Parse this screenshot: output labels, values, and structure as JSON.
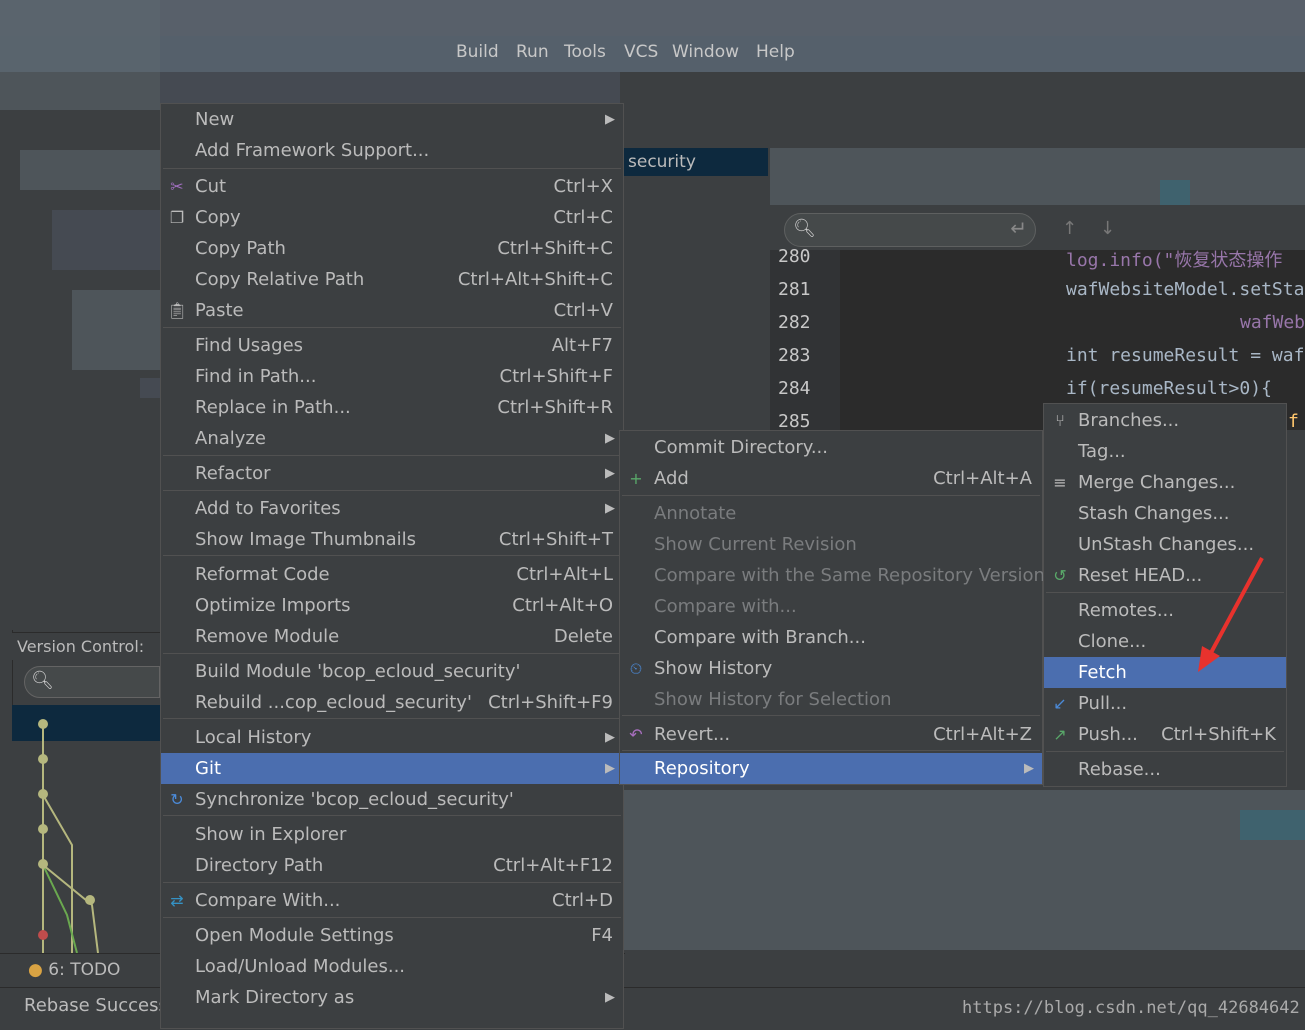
{
  "menubar": {
    "items": [
      "Build",
      "Run",
      "Tools",
      "VCS",
      "Window",
      "Help"
    ]
  },
  "project_tab": "security",
  "version_control": {
    "label": "Version Control:"
  },
  "bottom": {
    "todo": "6: TODO",
    "status": "Rebase Successf"
  },
  "watermark": "https://blog.csdn.net/qq_42684642",
  "editor": {
    "lines": [
      "280",
      "281",
      "282",
      "283",
      "284",
      "285"
    ],
    "code": [
      "log.info(\"恢复状态操作",
      "wafWebsiteModel.setSta",
      "wafWeb",
      "int resumeResult = waf",
      "if(resumeResult>0){",
      "f"
    ]
  },
  "context_menu": {
    "items": [
      {
        "label": "New",
        "shortcut": "",
        "submenu": true
      },
      {
        "label": "Add Framework Support...",
        "shortcut": ""
      },
      {
        "label": "Cut",
        "shortcut": "Ctrl+X",
        "icon": "scissors-icon"
      },
      {
        "label": "Copy",
        "shortcut": "Ctrl+C",
        "icon": "copy-icon"
      },
      {
        "label": "Copy Path",
        "shortcut": "Ctrl+Shift+C"
      },
      {
        "label": "Copy Relative Path",
        "shortcut": "Ctrl+Alt+Shift+C"
      },
      {
        "label": "Paste",
        "shortcut": "Ctrl+V",
        "icon": "paste-icon"
      },
      {
        "label": "Find Usages",
        "shortcut": "Alt+F7"
      },
      {
        "label": "Find in Path...",
        "shortcut": "Ctrl+Shift+F"
      },
      {
        "label": "Replace in Path...",
        "shortcut": "Ctrl+Shift+R"
      },
      {
        "label": "Analyze",
        "shortcut": "",
        "submenu": true
      },
      {
        "label": "Refactor",
        "shortcut": "",
        "submenu": true
      },
      {
        "label": "Add to Favorites",
        "shortcut": "",
        "submenu": true
      },
      {
        "label": "Show Image Thumbnails",
        "shortcut": "Ctrl+Shift+T"
      },
      {
        "label": "Reformat Code",
        "shortcut": "Ctrl+Alt+L"
      },
      {
        "label": "Optimize Imports",
        "shortcut": "Ctrl+Alt+O"
      },
      {
        "label": "Remove Module",
        "shortcut": "Delete"
      },
      {
        "label": "Build Module 'bcop_ecloud_security'",
        "shortcut": ""
      },
      {
        "label": "Rebuild ...cop_ecloud_security'",
        "shortcut": "Ctrl+Shift+F9"
      },
      {
        "label": "Local History",
        "shortcut": "",
        "submenu": true
      },
      {
        "label": "Git",
        "shortcut": "",
        "submenu": true,
        "selected": true
      },
      {
        "label": "Synchronize 'bcop_ecloud_security'",
        "shortcut": "",
        "icon": "sync-icon"
      },
      {
        "label": "Show in Explorer",
        "shortcut": ""
      },
      {
        "label": "Directory Path",
        "shortcut": "Ctrl+Alt+F12"
      },
      {
        "label": "Compare With...",
        "shortcut": "Ctrl+D",
        "icon": "compare-icon"
      },
      {
        "label": "Open Module Settings",
        "shortcut": "F4"
      },
      {
        "label": "Load/Unload Modules...",
        "shortcut": ""
      },
      {
        "label": "Mark Directory as",
        "shortcut": "",
        "submenu": true
      }
    ]
  },
  "git_menu": {
    "items": [
      {
        "label": "Commit Directory...",
        "shortcut": ""
      },
      {
        "label": "Add",
        "shortcut": "Ctrl+Alt+A",
        "icon": "plus-icon"
      },
      {
        "label": "Annotate",
        "shortcut": "",
        "disabled": true
      },
      {
        "label": "Show Current Revision",
        "shortcut": "",
        "disabled": true
      },
      {
        "label": "Compare with the Same Repository Version",
        "shortcut": "",
        "disabled": true
      },
      {
        "label": "Compare with...",
        "shortcut": "",
        "disabled": true
      },
      {
        "label": "Compare with Branch...",
        "shortcut": ""
      },
      {
        "label": "Show History",
        "shortcut": "",
        "icon": "history-icon"
      },
      {
        "label": "Show History for Selection",
        "shortcut": "",
        "disabled": true
      },
      {
        "label": "Revert...",
        "shortcut": "Ctrl+Alt+Z",
        "icon": "revert-icon"
      },
      {
        "label": "Repository",
        "shortcut": "",
        "submenu": true,
        "selected": true
      }
    ]
  },
  "repo_menu": {
    "items": [
      {
        "label": "Branches...",
        "shortcut": "",
        "icon": "branch-icon"
      },
      {
        "label": "Tag...",
        "shortcut": ""
      },
      {
        "label": "Merge Changes...",
        "shortcut": "",
        "icon": "merge-icon"
      },
      {
        "label": "Stash Changes...",
        "shortcut": ""
      },
      {
        "label": "UnStash Changes...",
        "shortcut": ""
      },
      {
        "label": "Reset HEAD...",
        "shortcut": "",
        "icon": "reset-icon"
      },
      {
        "label": "Remotes...",
        "shortcut": ""
      },
      {
        "label": "Clone...",
        "shortcut": ""
      },
      {
        "label": "Fetch",
        "shortcut": "",
        "selected": true
      },
      {
        "label": "Pull...",
        "shortcut": "",
        "icon": "pull-icon"
      },
      {
        "label": "Push...",
        "shortcut": "Ctrl+Shift+K",
        "icon": "push-icon"
      },
      {
        "label": "Rebase...",
        "shortcut": ""
      }
    ]
  },
  "colors": {
    "selection": "#4b6eaf",
    "menu_bg": "#3c3f41",
    "annotation_arrow": "#e8322d"
  }
}
